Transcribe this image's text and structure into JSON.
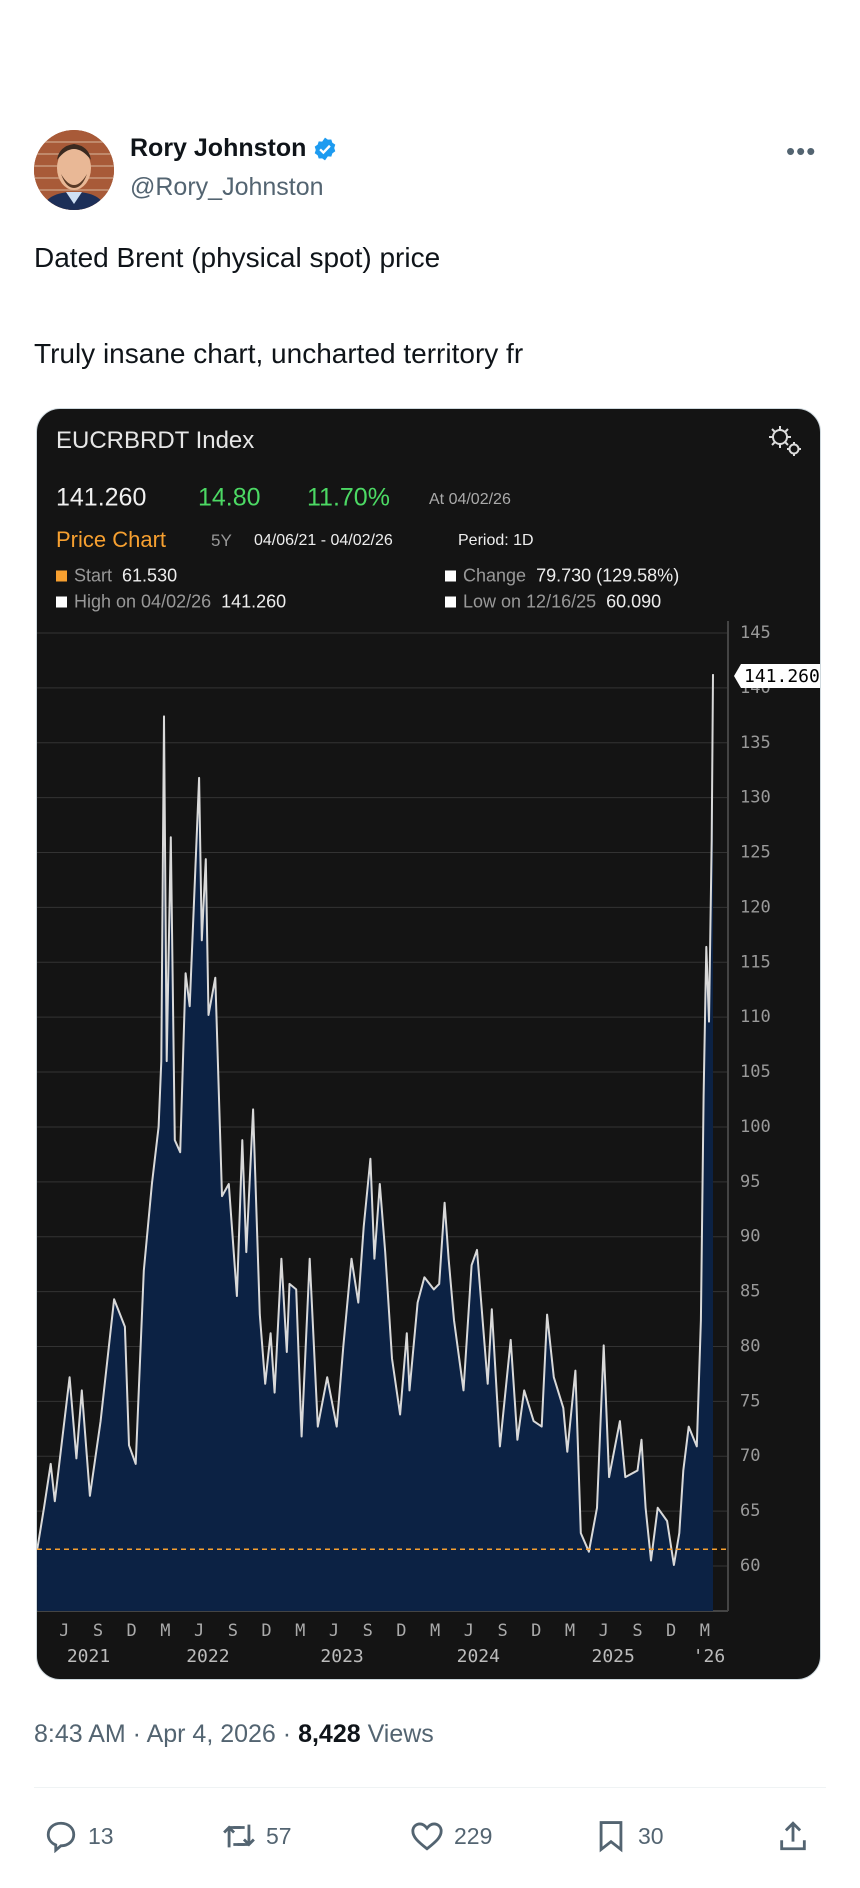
{
  "author": {
    "name": "Rory Johnston",
    "handle": "@Rory_Johnston",
    "verified": true
  },
  "more_icon": "more-horizontal-icon",
  "tweet": {
    "lines": [
      "Dated Brent (physical spot) price",
      "Truly insane chart, uncharted territory fr"
    ]
  },
  "card": {
    "title": "EUCRBRDT Index",
    "last": "141.260",
    "change": "14.80",
    "change_pct": "11.70%",
    "as_of": "At 04/02/26",
    "section": "Price Chart",
    "range": "5Y",
    "dates": "04/06/21 - 04/02/26",
    "period": "Period: 1D",
    "stats": {
      "start_label": "Start",
      "start_value": "61.530",
      "change_label": "Change",
      "change_value": "79.730 (129.58%)",
      "high_label": "High on 04/02/26",
      "high_value": "141.260",
      "low_label": "Low on 12/16/25",
      "low_value": "60.090"
    },
    "colors": {
      "accent": "#f7a030",
      "up": "#4cd964",
      "area": "#0c2244",
      "line": "#d9d9d9"
    }
  },
  "chart_data": {
    "type": "area",
    "title": "EUCRBRDT Index",
    "xlabel": "",
    "ylabel": "",
    "ylim": [
      56,
      145
    ],
    "xlim": [
      2021.263,
      2026.26
    ],
    "yticks": [
      "60",
      "65",
      "70",
      "75",
      "80",
      "85",
      "90",
      "95",
      "100",
      "105",
      "110",
      "115",
      "120",
      "125",
      "130",
      "135",
      "140",
      "145"
    ],
    "month_ticks": [
      "J",
      "S",
      "D",
      "M",
      "J",
      "S",
      "D",
      "M",
      "J",
      "S",
      "D",
      "M",
      "J",
      "S",
      "D",
      "M",
      "J",
      "S",
      "D",
      "M"
    ],
    "month_tick_start": 2021.45,
    "month_tick_step": 0.25,
    "year_labels": [
      {
        "label": "2021",
        "x": 2021.63
      },
      {
        "label": "2022",
        "x": 2022.515
      },
      {
        "label": "2023",
        "x": 2023.51
      },
      {
        "label": "2024",
        "x": 2024.52
      },
      {
        "label": "2025",
        "x": 2025.52
      },
      {
        "label": "'26",
        "x": 2026.23
      }
    ],
    "reference_line": {
      "label": "Start",
      "value": 61.53
    },
    "last_label": "141.260",
    "grid": true,
    "x": [
      2021.25,
      2021.3,
      2021.35,
      2021.38,
      2021.49,
      2021.54,
      2021.58,
      2021.64,
      2021.72,
      2021.82,
      2021.9,
      2021.93,
      2021.98,
      2022.04,
      2022.1,
      2022.15,
      2022.17,
      2022.19,
      2022.21,
      2022.24,
      2022.27,
      2022.31,
      2022.35,
      2022.38,
      2022.45,
      2022.47,
      2022.5,
      2022.52,
      2022.57,
      2022.62,
      2022.67,
      2022.73,
      2022.77,
      2022.8,
      2022.85,
      2022.9,
      2022.94,
      2022.98,
      2023.01,
      2023.06,
      2023.1,
      2023.12,
      2023.17,
      2023.21,
      2023.27,
      2023.33,
      2023.4,
      2023.47,
      2023.52,
      2023.58,
      2023.63,
      2023.67,
      2023.72,
      2023.75,
      2023.79,
      2023.83,
      2023.88,
      2023.94,
      2023.99,
      2024.01,
      2024.07,
      2024.12,
      2024.19,
      2024.23,
      2024.27,
      2024.3,
      2024.34,
      2024.41,
      2024.47,
      2024.51,
      2024.59,
      2024.62,
      2024.68,
      2024.76,
      2024.81,
      2024.86,
      2024.93,
      2024.99,
      2025.03,
      2025.08,
      2025.15,
      2025.18,
      2025.24,
      2025.28,
      2025.34,
      2025.4,
      2025.45,
      2025.49,
      2025.57,
      2025.61,
      2025.7,
      2025.73,
      2025.76,
      2025.8,
      2025.85,
      2025.92,
      2025.97,
      2026.01,
      2026.04,
      2026.08,
      2026.14,
      2026.17,
      2026.19,
      2026.21,
      2026.23,
      2026.25,
      2026.26
    ],
    "values": [
      61.5,
      65.3,
      69.3,
      65.9,
      77.2,
      69.8,
      76,
      66.4,
      73.2,
      84.3,
      81.8,
      71,
      69.3,
      86.9,
      94.8,
      100,
      106,
      137.4,
      106,
      126.4,
      98.8,
      97.7,
      114,
      111,
      131.8,
      117,
      124.4,
      110.2,
      113.6,
      93.7,
      94.8,
      84.6,
      98.8,
      88.6,
      101.6,
      82.9,
      76.6,
      81.2,
      75.8,
      88,
      79.5,
      85.7,
      85.2,
      71.8,
      88,
      72.7,
      77.2,
      72.7,
      80.1,
      88,
      84,
      90.9,
      97.1,
      88,
      94.8,
      88.6,
      78.9,
      73.8,
      81.2,
      76,
      84,
      86.3,
      85.2,
      85.7,
      93.1,
      88,
      82.4,
      76,
      87.4,
      88.8,
      76.6,
      83.4,
      70.9,
      80.6,
      71.5,
      76,
      73.2,
      72.7,
      82.9,
      77.2,
      74.4,
      70.4,
      77.8,
      63,
      61.3,
      65.3,
      80.1,
      68.1,
      73.2,
      68.1,
      68.7,
      71.5,
      65.3,
      60.5,
      65.3,
      64.1,
      60.09,
      63,
      68.7,
      72.7,
      70.9,
      82.4,
      102.8,
      116.4,
      109.6,
      126.1,
      141.26
    ]
  },
  "footer": {
    "time": "8:43 AM",
    "sep": " · ",
    "date": "Apr 4, 2026",
    "views_count": "8,428",
    "views_label": " Views",
    "actions": {
      "replies": "13",
      "reposts": "57",
      "likes": "229",
      "bookmarks": "30"
    }
  }
}
